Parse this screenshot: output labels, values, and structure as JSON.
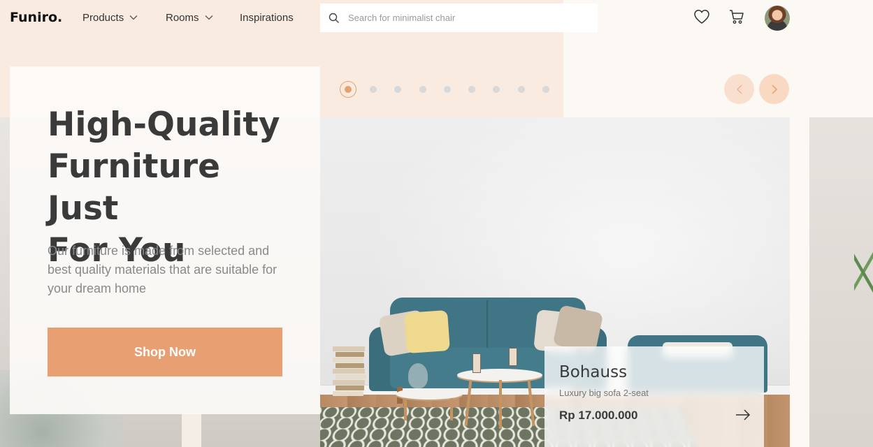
{
  "header": {
    "logo": "Funiro.",
    "nav": [
      {
        "label": "Products",
        "has_dropdown": true
      },
      {
        "label": "Rooms",
        "has_dropdown": true
      },
      {
        "label": "Inspirations",
        "has_dropdown": false
      }
    ],
    "search": {
      "placeholder": "Search for minimalist chair",
      "value": ""
    },
    "icons": [
      "search-icon",
      "heart-icon",
      "cart-icon",
      "avatar"
    ]
  },
  "hero": {
    "title_lines": [
      "High-Quality",
      "Furniture Just",
      "For You"
    ],
    "subtitle": "Our furniture is made from selected and best quality materials that are suitable for your dream home",
    "cta_label": "Shop Now"
  },
  "slider": {
    "total_slides": 9,
    "active_index": 0,
    "prev_icon": "chevron-left-icon",
    "next_icon": "chevron-right-icon"
  },
  "product": {
    "name": "Bohauss",
    "description": "Luxury big sofa 2-seat",
    "price": "Rp 17.000.000",
    "action_icon": "arrow-right-icon"
  },
  "colors": {
    "accent": "#e89f71",
    "accent_light": "#f9d9c2",
    "peach_background": "#f9ebe0",
    "page_background": "#fcf8f3",
    "text_dark": "#3a3a3a",
    "text_muted": "#898989",
    "sofa_teal": "#3f7584"
  }
}
